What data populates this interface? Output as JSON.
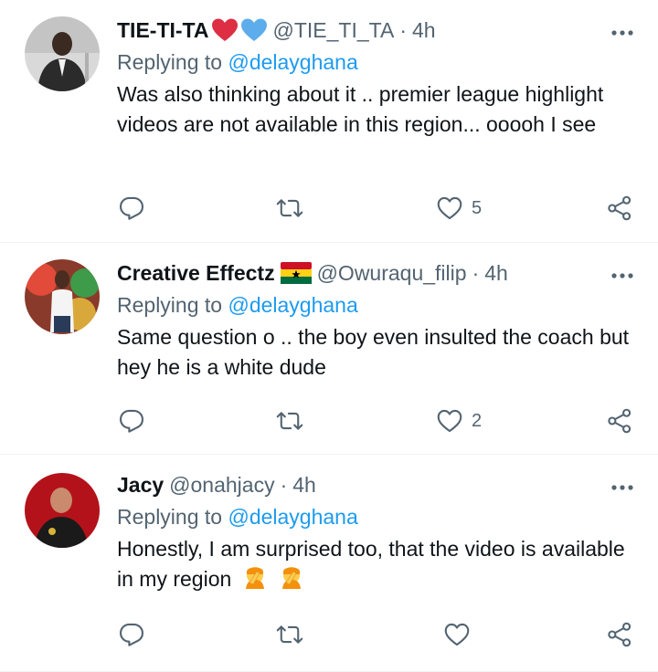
{
  "tweets": [
    {
      "name": "TIE-TI-TA",
      "name_emoji": [
        "red-heart-emoji",
        "blue-heart-emoji"
      ],
      "handle": "@TIE_TI_TA",
      "separator": "·",
      "time": "4h",
      "replying_prefix": "Replying to",
      "replying_to": "@delayghana",
      "text": "Was also thinking about it ..  premier league highlight videos are not available in this region... ooooh I see",
      "like_count": "5",
      "avatar": "man-in-dark-suit-avatar"
    },
    {
      "name": "Creative Effectz",
      "name_emoji": [
        "ghana-flag-emoji"
      ],
      "handle": "@Owuraqu_filip",
      "separator": "·",
      "time": "4h",
      "replying_prefix": "Replying to",
      "replying_to": "@delayghana",
      "text": "Same question o .. the boy even insulted the coach but hey he is a white dude",
      "like_count": "2",
      "avatar": "man-in-white-shirt-avatar"
    },
    {
      "name": "Jacy",
      "name_emoji": [],
      "handle": "@onahjacy",
      "separator": "·",
      "time": "4h",
      "replying_prefix": "Replying to",
      "replying_to": "@delayghana",
      "text": "Honestly, I am surprised too, that the video is available in my region",
      "text_emoji": [
        "facepalm-emoji",
        "facepalm-emoji"
      ],
      "like_count": "",
      "avatar": "man-red-background-avatar"
    }
  ],
  "colors": {
    "text": "#0f1419",
    "secondary": "#536471",
    "link": "#1d9bf0",
    "divider": "#eff3f4"
  }
}
